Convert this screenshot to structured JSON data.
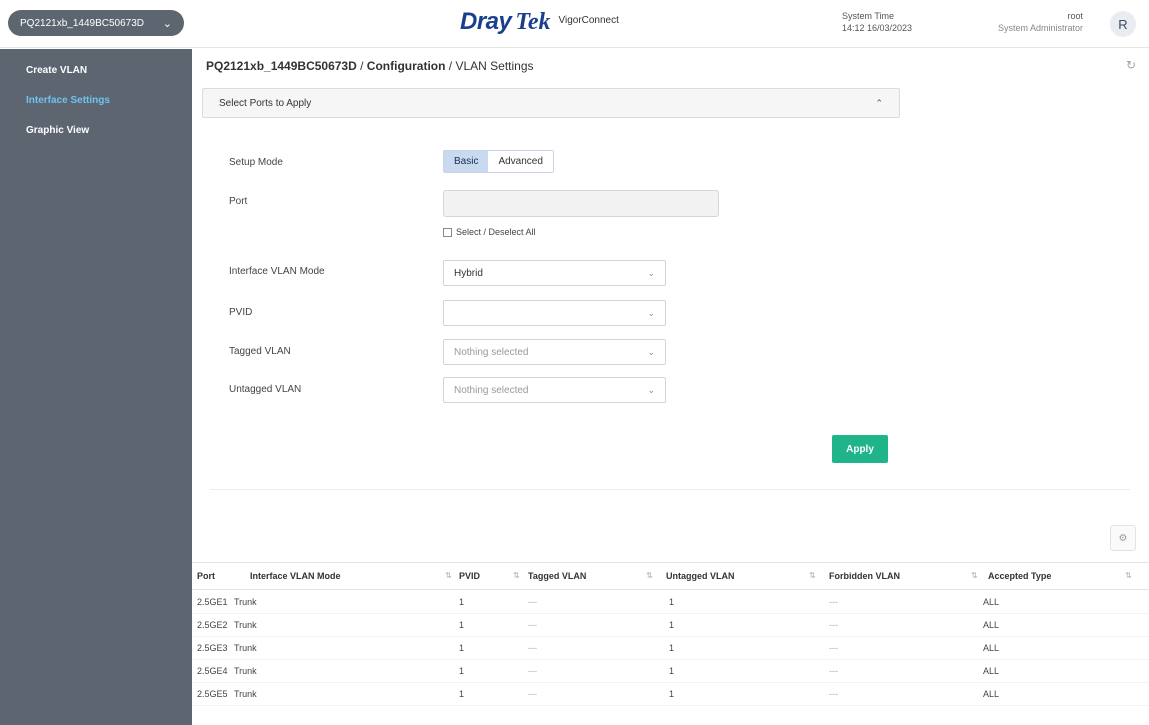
{
  "header": {
    "device": "PQ2121xb_1449BC50673D",
    "brand_left": "Dray",
    "brand_right": "Tek",
    "product": "VigorConnect",
    "system_time_label": "System Time",
    "system_time_value": "14:12 16/03/2023",
    "user_name": "root",
    "user_role": "System Administrator",
    "avatar_letter": "R"
  },
  "sidebar": {
    "items": [
      {
        "label": "Create VLAN"
      },
      {
        "label": "Interface Settings"
      },
      {
        "label": "Graphic View"
      }
    ]
  },
  "breadcrumb": {
    "device": "PQ2121xb_1449BC50673D",
    "section": "Configuration",
    "page": "VLAN Settings"
  },
  "panel": {
    "title": "Select Ports to Apply"
  },
  "form": {
    "setup_mode_label": "Setup Mode",
    "mode_basic": "Basic",
    "mode_advanced": "Advanced",
    "port_label": "Port",
    "port_value": "",
    "select_all_label": "Select / Deselect All",
    "interface_mode_label": "Interface VLAN Mode",
    "interface_mode_value": "Hybrid",
    "pvid_label": "PVID",
    "pvid_value": "",
    "tagged_label": "Tagged VLAN",
    "tagged_placeholder": "Nothing selected",
    "untagged_label": "Untagged VLAN",
    "untagged_placeholder": "Nothing selected",
    "apply_label": "Apply"
  },
  "table": {
    "columns": [
      "Port",
      "Interface VLAN Mode",
      "PVID",
      "Tagged VLAN",
      "Untagged VLAN",
      "Forbidden VLAN",
      "Accepted Type"
    ],
    "rows": [
      [
        "2.5GE1",
        "Trunk",
        "1",
        "---",
        "1",
        "---",
        "ALL"
      ],
      [
        "2.5GE2",
        "Trunk",
        "1",
        "---",
        "1",
        "---",
        "ALL"
      ],
      [
        "2.5GE3",
        "Trunk",
        "1",
        "---",
        "1",
        "---",
        "ALL"
      ],
      [
        "2.5GE4",
        "Trunk",
        "1",
        "---",
        "1",
        "---",
        "ALL"
      ],
      [
        "2.5GE5",
        "Trunk",
        "1",
        "---",
        "1",
        "---",
        "ALL"
      ]
    ]
  },
  "colors": {
    "sidebar_bg": "#5d6670",
    "sidebar_active": "#6ec3f0",
    "apply_button": "#1fb489",
    "brand": "#1a3f8c"
  }
}
